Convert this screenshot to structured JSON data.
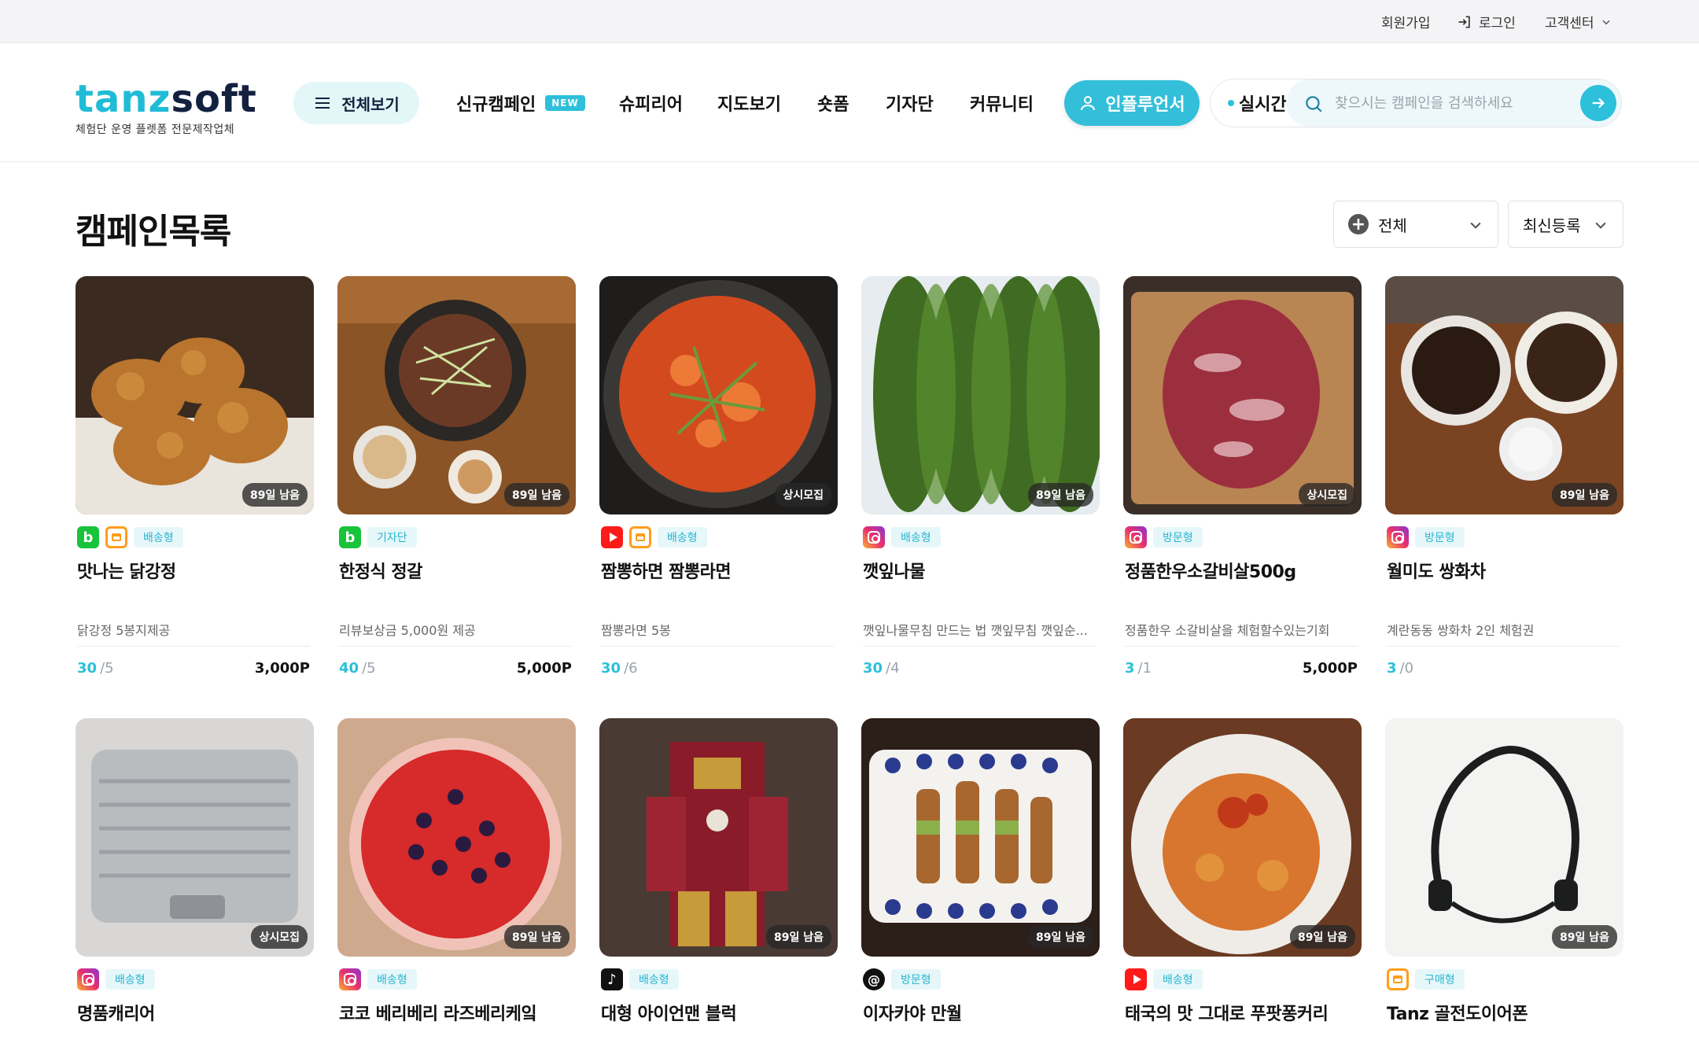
{
  "topbar": {
    "signup": "회원가입",
    "login": "로그인",
    "support": "고객센터"
  },
  "logo": {
    "word_a": "tanz",
    "word_b": "soft",
    "tagline": "체험단 운영 플렛폼 전문제작업체"
  },
  "nav": {
    "all_label": "전체보기",
    "items": [
      "신규캠페인",
      "슈피리어",
      "지도보기",
      "숏폼",
      "기자단",
      "커뮤니티"
    ],
    "new_badge": "NEW",
    "influencer_label": "인플루언서",
    "live_label": "실시간",
    "search_placeholder": "찾으시는 캠페인을 검색하세요"
  },
  "main": {
    "title": "캠페인목록",
    "filter_category": "전체",
    "filter_sort": "최신등록"
  },
  "colors": {
    "accent": "#2cc0da",
    "brand_dark": "#13213f"
  },
  "campaigns": [
    {
      "title": "맛나는 닭강정",
      "desc": "닭강정 5봉지제공",
      "badge": "89일 남음",
      "channels": [
        "blog-icon",
        "store-icon"
      ],
      "type": "배송형",
      "applied": "30",
      "capacity": "/5",
      "point": "3,000P"
    },
    {
      "title": "한정식 정갈",
      "desc": "리뷰보상금 5,000원 제공",
      "badge": "89일 남음",
      "channels": [
        "blog-icon"
      ],
      "type": "기자단",
      "applied": "40",
      "capacity": "/5",
      "point": "5,000P"
    },
    {
      "title": "짬뽕하면 짬뽕라면",
      "desc": "짬뽕라면 5봉",
      "badge": "상시모집",
      "channels": [
        "youtube-icon",
        "store-icon"
      ],
      "type": "배송형",
      "applied": "30",
      "capacity": "/6",
      "point": ""
    },
    {
      "title": "깻잎나물",
      "desc": "깻잎나물무침 만드는 법 깻잎무침 깻잎순...",
      "badge": "89일 남음",
      "channels": [
        "instagram-icon"
      ],
      "type": "배송형",
      "applied": "30",
      "capacity": "/4",
      "point": ""
    },
    {
      "title": "정품한우소갈비살500g",
      "desc": "정품한우 소갈비살을 체험할수있는기회",
      "badge": "상시모집",
      "channels": [
        "instagram-icon"
      ],
      "type": "방문형",
      "applied": "3",
      "capacity": "/1",
      "point": "5,000P"
    },
    {
      "title": "월미도 쌍화차",
      "desc": "계란동동 쌍화차 2인 체험권",
      "badge": "89일 남음",
      "channels": [
        "instagram-icon"
      ],
      "type": "방문형",
      "applied": "3",
      "capacity": "/0",
      "point": ""
    },
    {
      "title": "명품캐리어",
      "desc": "",
      "badge": "상시모집",
      "channels": [
        "instagram-icon"
      ],
      "type": "배송형",
      "applied": "",
      "capacity": "",
      "point": ""
    },
    {
      "title": "코코 베리베리 라즈베리케잌",
      "desc": "",
      "badge": "89일 남음",
      "channels": [
        "instagram-icon"
      ],
      "type": "배송형",
      "applied": "",
      "capacity": "",
      "point": ""
    },
    {
      "title": "대형 아이언맨 블럭",
      "desc": "",
      "badge": "89일 남음",
      "channels": [
        "tiktok-icon"
      ],
      "type": "배송형",
      "applied": "",
      "capacity": "",
      "point": ""
    },
    {
      "title": "이자카야 만월",
      "desc": "",
      "badge": "89일 남음",
      "channels": [
        "threads-icon"
      ],
      "type": "방문형",
      "applied": "",
      "capacity": "",
      "point": ""
    },
    {
      "title": "태국의 맛 그대로 푸팟퐁커리",
      "desc": "",
      "badge": "89일 남음",
      "channels": [
        "youtube-icon"
      ],
      "type": "배송형",
      "applied": "",
      "capacity": "",
      "point": ""
    },
    {
      "title": "Tanz 골전도이어폰",
      "desc": "",
      "badge": "89일 남음",
      "channels": [
        "store-icon"
      ],
      "type": "구매형",
      "applied": "",
      "capacity": "",
      "point": ""
    }
  ]
}
